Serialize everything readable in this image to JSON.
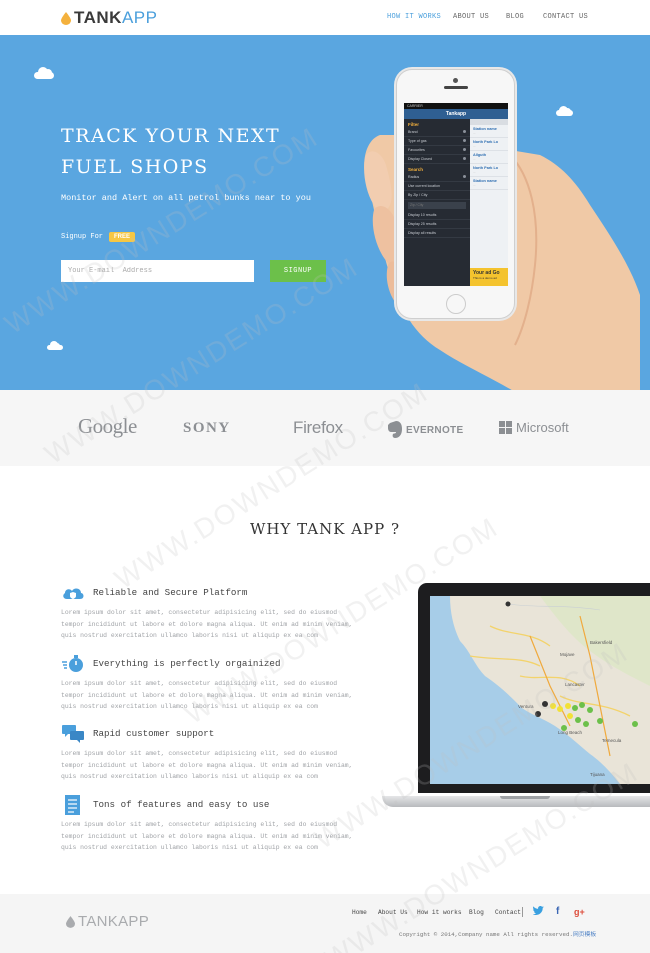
{
  "nav": {
    "logo_part1": "TANK",
    "logo_part2": "APP",
    "items": [
      {
        "label": "HOW IT WORKS"
      },
      {
        "label": "ABOUT US"
      },
      {
        "label": "BLOG"
      },
      {
        "label": "CONTACT US"
      }
    ],
    "accent_color": "#4a9fdc"
  },
  "hero": {
    "title": "TRACK YOUR NEXT\nFUEL SHOPS",
    "subtitle": "Monitor and Alert on all petrol bunks near to you",
    "signup_for": "Signup For",
    "free_badge": "FREE",
    "email_placeholder": "Your E-mail  Address",
    "signup_button": "SIGNUP",
    "bg_color": "#5aa6e0",
    "button_color": "#6cc04a"
  },
  "phone_app": {
    "carrier": "CARRIER",
    "app_title": "Tankapp",
    "filter_heading": "Filter",
    "filter_rows": [
      "Brand",
      "Type of gas",
      "Favourites",
      "Display Closed"
    ],
    "search_heading": "Search",
    "radius_label": "Radius",
    "location_rows": [
      "Use current location",
      "By Zip / City"
    ],
    "zip_placeholder": "Zip / City",
    "display_rows": [
      "Display 10 results",
      "Display 25 results",
      "Display all results"
    ],
    "list_items": [
      {
        "name": "Station name",
        "detail": "..."
      },
      {
        "name": "North Park Lo",
        "detail": "..."
      },
      {
        "name": "Allguth",
        "detail": "..."
      },
      {
        "name": "North Park Lo",
        "detail": "..."
      },
      {
        "name": "Station name",
        "detail": "..."
      }
    ],
    "ad_title": "Your ad Go",
    "ad_sub": "This is a demo ad"
  },
  "brands": [
    "Google",
    "SONY",
    "Firefox",
    "EVERNOTE",
    "Microsoft"
  ],
  "why": {
    "title": "WHY TANK APP ?",
    "features": [
      {
        "icon": "cloud-shield-icon",
        "heading": "Reliable and Secure Platform",
        "body": "Lorem ipsum dolor sit amet, consectetur adipisicing elit, sed do eiusmod tempor incididunt ut labore et dolore magna aliqua. Ut enim ad minim veniam, quis nostrud exercitation ullamco laboris nisi ut aliquip ex ea com"
      },
      {
        "icon": "stopwatch-icon",
        "heading": "Everything is perfectly orgainized",
        "body": "Lorem ipsum dolor sit amet, consectetur adipisicing elit, sed do eiusmod tempor incididunt ut labore et dolore magna aliqua. Ut enim ad minim veniam, quis nostrud exercitation ullamco laboris nisi ut aliquip ex ea com"
      },
      {
        "icon": "chat-bubbles-icon",
        "heading": "Rapid customer support",
        "body": "Lorem ipsum dolor sit amet, consectetur adipisicing elit, sed do eiusmod tempor incididunt ut labore et dolore magna aliqua. Ut enim ad minim veniam, quis nostrud exercitation ullamco laboris nisi ut aliquip ex ea com"
      },
      {
        "icon": "document-list-icon",
        "heading": "Tons of features and easy to use",
        "body": "Lorem ipsum dolor sit amet, consectetur adipisicing elit, sed do eiusmod tempor incididunt ut labore et dolore magna aliqua. Ut enim ad minim veniam, quis nostrud exercitation ullamco laboris nisi ut aliquip ex ea com"
      }
    ]
  },
  "map_labels": [
    "Mojave",
    "Lancaster",
    "Bakersfield",
    "Ventura",
    "Tijuana",
    "Long Beach",
    "Temecula"
  ],
  "footer": {
    "logo_part1": "TANK",
    "logo_part2": "APP",
    "links": [
      "Home",
      "About Us",
      "How it works",
      "Blog",
      "Contact"
    ],
    "copyright": "Copyright © 2014,Company name All rights reserved.",
    "template_link": "网页模板"
  },
  "watermark": "WWW.DOWNDEMO.COM"
}
